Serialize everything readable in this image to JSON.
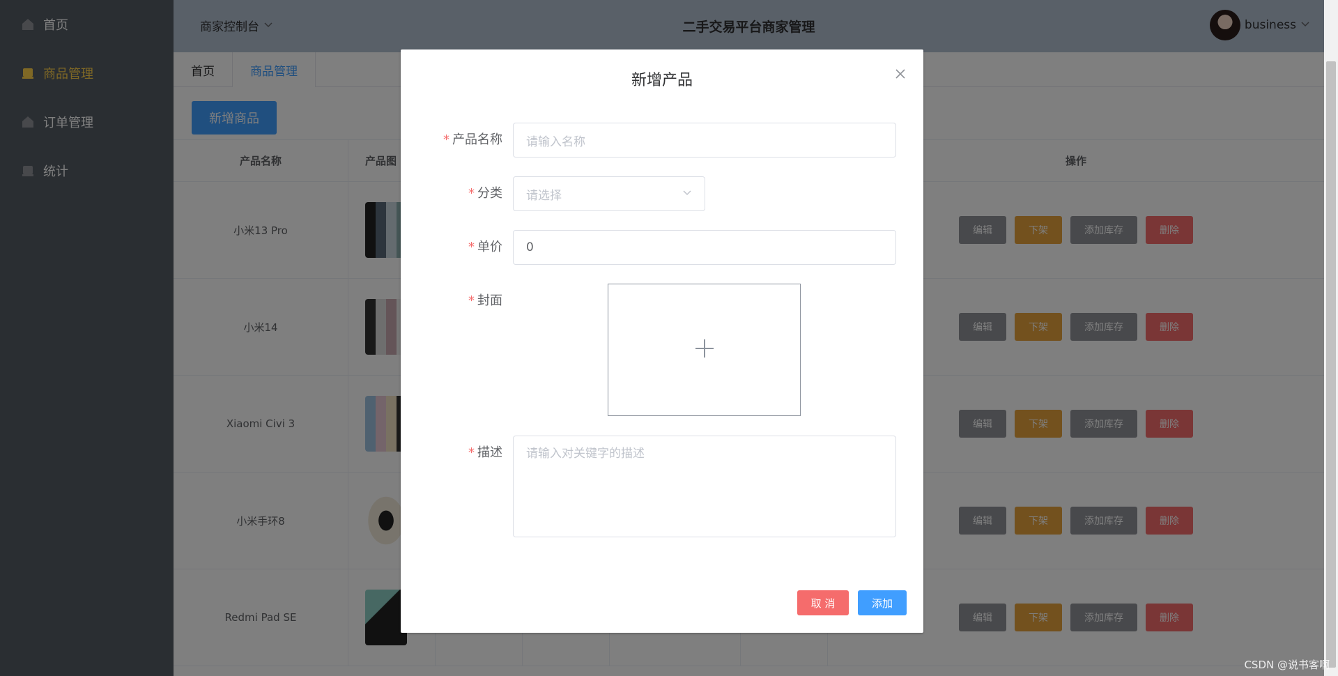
{
  "sidebar": {
    "items": [
      {
        "label": "首页",
        "icon": "home-icon"
      },
      {
        "label": "商品管理",
        "icon": "goods-icon"
      },
      {
        "label": "订单管理",
        "icon": "home-icon"
      },
      {
        "label": "统计",
        "icon": "goods-icon"
      }
    ],
    "active_color": "#ffd04b"
  },
  "header": {
    "console_label": "商家控制台",
    "title": "二手交易平台商家管理",
    "username": "business"
  },
  "tabs": [
    {
      "label": "首页"
    },
    {
      "label": "商品管理"
    }
  ],
  "toolbar": {
    "add_label": "新增商品"
  },
  "table": {
    "headers": [
      "产品名称",
      "产品图",
      "",
      "",
      "",
      "",
      "操作"
    ],
    "rows": [
      {
        "name": "小米13 Pro"
      },
      {
        "name": "小米14"
      },
      {
        "name": "Xiaomi Civi 3"
      },
      {
        "name": "小米手环8"
      },
      {
        "name": "Redmi Pad SE"
      }
    ],
    "ops": {
      "edit": "编辑",
      "down": "下架",
      "stock": "添加库存",
      "delete": "删除"
    }
  },
  "dialog": {
    "title": "新增产品",
    "fields": {
      "name_label": "产品名称",
      "name_placeholder": "请输入名称",
      "category_label": "分类",
      "category_placeholder": "请选择",
      "price_label": "单价",
      "price_value": "0",
      "cover_label": "封面",
      "desc_label": "描述",
      "desc_placeholder": "请输入对关键字的描述"
    },
    "cancel_label": "取 消",
    "confirm_label": "添加"
  },
  "watermark": "CSDN @说书客啊"
}
